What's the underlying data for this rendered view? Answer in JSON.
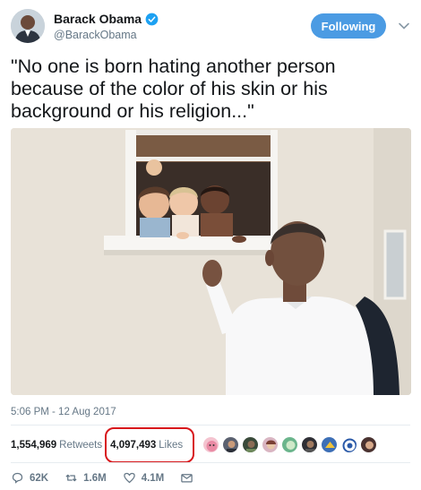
{
  "user": {
    "display_name": "Barack Obama",
    "handle": "@BarackObama",
    "verified_icon": "verified-badge-icon"
  },
  "follow_button": {
    "label": "Following"
  },
  "tweet": {
    "text": "\"No one is born hating another person because of the color of his skin or his background or his religion...\"",
    "timestamp": "5:06 PM - 12 Aug 2017"
  },
  "stats": {
    "retweets_count": "1,554,969",
    "retweets_label": "Retweets",
    "likes_count": "4,097,493",
    "likes_label": "Likes"
  },
  "actions": {
    "reply_count": "62K",
    "retweet_count": "1.6M",
    "like_count": "4.1M"
  },
  "colors": {
    "follow_blue": "#4b9be3",
    "highlight_red": "#d8171c",
    "muted": "#657786"
  }
}
